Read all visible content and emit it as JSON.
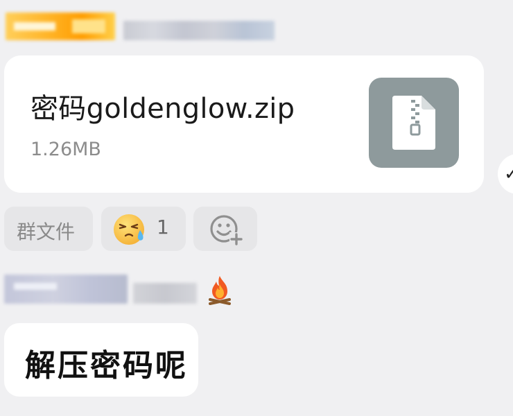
{
  "file_message": {
    "file_name": "密码goldenglow.zip",
    "file_size": "1.26MB",
    "file_icon": "zip-file-icon",
    "icon_tile_color": "#8e9a9c"
  },
  "chips": {
    "group_file_label": "群文件",
    "reaction_emoji": "sweating-frustrated-face",
    "reaction_count": "1",
    "add_reaction_icon": "add-emoji-icon"
  },
  "reply_message": {
    "text": "解压密码呢"
  },
  "sender_badges": {
    "second_sender_icon": "fire-icon"
  },
  "colors": {
    "background": "#f0f0f2",
    "bubble": "#ffffff",
    "chip": "#e6e6e8"
  }
}
